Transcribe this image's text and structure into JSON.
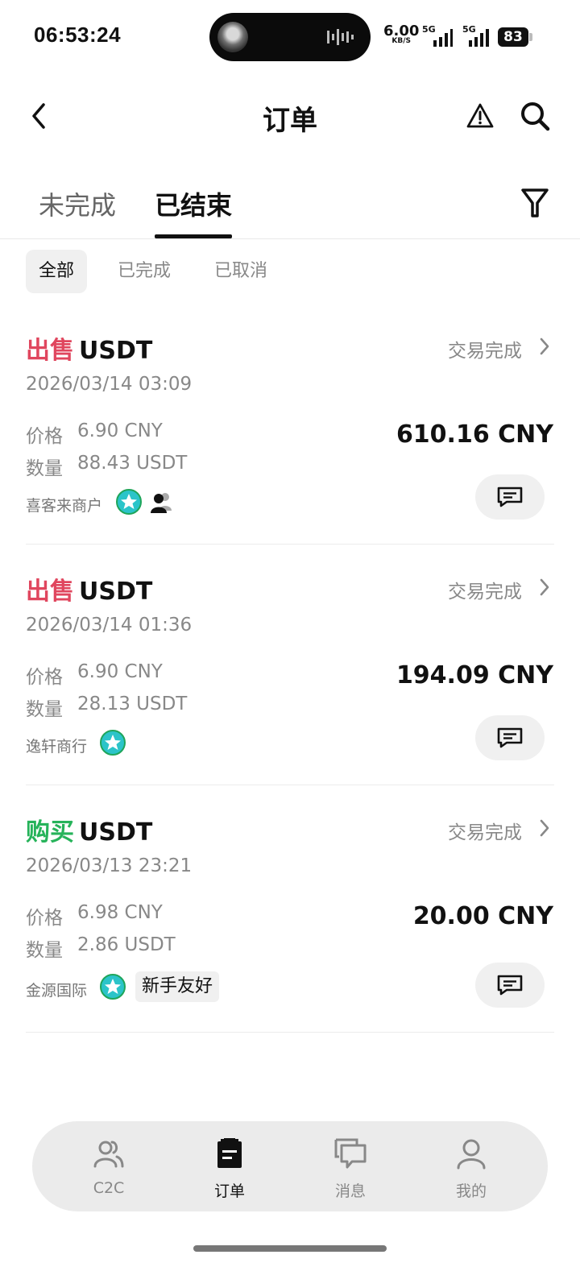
{
  "status_bar": {
    "time": "06:53:24",
    "net_speed": "6.00",
    "net_unit": "KB/S",
    "sim1": "5G",
    "sim2": "5G",
    "battery": "83"
  },
  "header": {
    "title": "订单",
    "back_icon": "chevron-left-icon",
    "warning_icon": "warning-triangle-icon",
    "search_icon": "search-icon"
  },
  "tabs": [
    {
      "label": "未完成",
      "active": false
    },
    {
      "label": "已结束",
      "active": true
    }
  ],
  "filters": [
    {
      "label": "全部",
      "active": true
    },
    {
      "label": "已完成",
      "active": false
    },
    {
      "label": "已取消",
      "active": false
    }
  ],
  "orders": [
    {
      "side": "出售",
      "side_type": "sell",
      "asset": "USDT",
      "status": "交易完成",
      "date": "2026/03/14 03:09",
      "price_label": "价格",
      "price": "6.90 CNY",
      "qty_label": "数量",
      "qty": "88.43 USDT",
      "total": "610.16 CNY",
      "merchant": "喜客来商户",
      "tag": ""
    },
    {
      "side": "出售",
      "side_type": "sell",
      "asset": "USDT",
      "status": "交易完成",
      "date": "2026/03/14 01:36",
      "price_label": "价格",
      "price": "6.90 CNY",
      "qty_label": "数量",
      "qty": "28.13 USDT",
      "total": "194.09 CNY",
      "merchant": "逸轩商行",
      "tag": ""
    },
    {
      "side": "购买",
      "side_type": "buy",
      "asset": "USDT",
      "status": "交易完成",
      "date": "2026/03/13 23:21",
      "price_label": "价格",
      "price": "6.98 CNY",
      "qty_label": "数量",
      "qty": "2.86 USDT",
      "total": "20.00 CNY",
      "merchant": "金源国际",
      "tag": "新手友好"
    }
  ],
  "bottom_nav": [
    {
      "label": "C2C",
      "icon": "users-icon",
      "active": false
    },
    {
      "label": "订单",
      "icon": "clipboard-icon",
      "active": true
    },
    {
      "label": "消息",
      "icon": "chat-bubbles-icon",
      "active": false
    },
    {
      "label": "我的",
      "icon": "person-icon",
      "active": false
    }
  ],
  "colors": {
    "sell": "#e0465e",
    "buy": "#26b35a",
    "badge": "#2bc4c9"
  }
}
